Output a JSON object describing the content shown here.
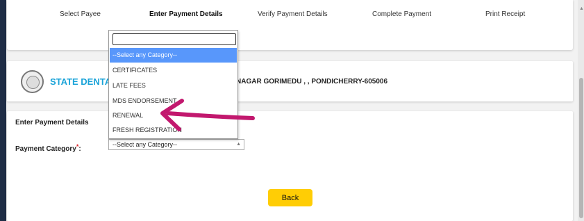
{
  "steps": [
    {
      "label": "Select Payee",
      "active": false
    },
    {
      "label": "Enter Payment Details",
      "active": true
    },
    {
      "label": "Verify Payment Details",
      "active": false
    },
    {
      "label": "Complete Payment",
      "active": false
    },
    {
      "label": "Print Receipt",
      "active": false
    }
  ],
  "org": {
    "name": "STATE DENTAL",
    "address": "NAGAR GORIMEDU , , PONDICHERRY-605006"
  },
  "form": {
    "section_title": "Enter Payment Details",
    "category_label": "Payment Category",
    "required_mark": "*",
    "label_colon": ":",
    "selected_value": "--Select any Category--",
    "back_label": "Back"
  },
  "dropdown": {
    "search_value": "",
    "options": [
      "--Select any Category--",
      "CERTIFICATES",
      "LATE FEES",
      "MDS ENDORSEMENT",
      "RENEWAL",
      "FRESH REGISTRATION"
    ],
    "highlighted_index": 0
  },
  "colors": {
    "accent_yellow": "#ffcd05",
    "highlight_blue": "#5897fb",
    "org_blue": "#1aa3d8",
    "annotation_arrow": "#c2186e",
    "required_red": "#e0262b"
  },
  "icons": {
    "seal": "institution-seal-icon",
    "caret": "caret-up-icon",
    "annotation": "arrow-left-icon"
  }
}
